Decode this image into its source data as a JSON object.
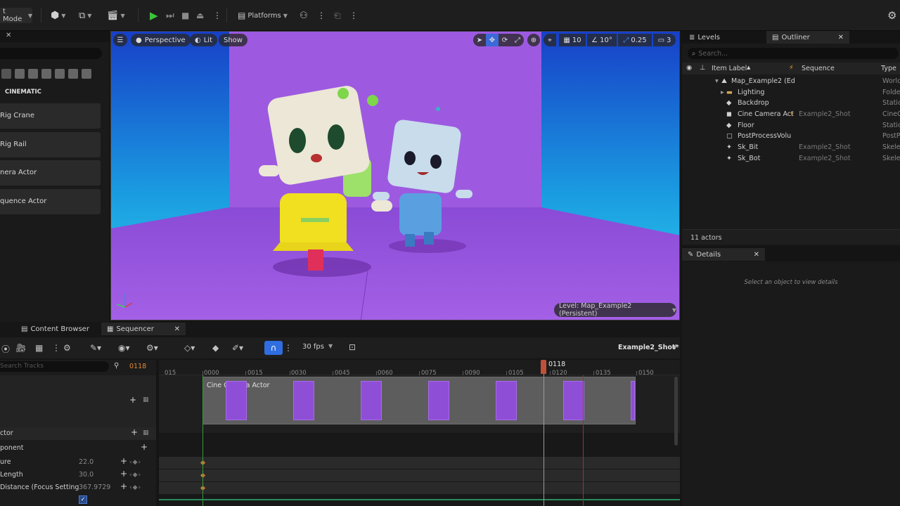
{
  "toolbar": {
    "mode_label": "t Mode",
    "platforms_label": "Platforms"
  },
  "left_panel": {
    "section_title": "CINEMATIC",
    "items": [
      "Rig Crane",
      "Rig Rail",
      "nera Actor",
      "quence Actor"
    ]
  },
  "viewport": {
    "perspective_label": "Perspective",
    "lit_label": "Lit",
    "show_label": "Show",
    "grid_value": "10",
    "angle_value": "10°",
    "scale_value": "0.25",
    "camera_speed": "3",
    "level_label": "Level: Map_Example2 (Persistent)"
  },
  "outliner": {
    "levels_tab": "Levels",
    "outliner_tab": "Outliner",
    "search_placeholder": "Search...",
    "col_item_label": "Item Label",
    "col_sequence": "Sequence",
    "col_type": "Type",
    "rows": [
      {
        "label": "Map_Example2 (Ed",
        "sequence": "",
        "type": "World"
      },
      {
        "label": "Lighting",
        "sequence": "",
        "type": "Folder"
      },
      {
        "label": "Backdrop",
        "sequence": "",
        "type": "Static"
      },
      {
        "label": "Cine Camera Act",
        "sequence": "Example2_Shot",
        "type": "CineC"
      },
      {
        "label": "Floor",
        "sequence": "",
        "type": "Static"
      },
      {
        "label": "PostProcessVolu",
        "sequence": "",
        "type": "PostP"
      },
      {
        "label": "Sk_Bit",
        "sequence": "Example2_Shot",
        "type": "Skele"
      },
      {
        "label": "Sk_Bot",
        "sequence": "Example2_Shot",
        "type": "Skele"
      }
    ],
    "actor_count": "11 actors"
  },
  "details": {
    "tab_label": "Details",
    "empty_text": "Select an object to view details"
  },
  "sequencer": {
    "content_browser_tab": "Content Browser",
    "sequencer_tab": "Sequencer",
    "fps_label": "30 fps",
    "sequence_name": "Example2_Shot*",
    "search_placeholder": "Search Tracks",
    "current_frame": "0118",
    "playhead_label": "0118",
    "ticks": [
      "015",
      "0000",
      "0015",
      "0030",
      "0045",
      "0060",
      "0075",
      "0090",
      "0105",
      "0120",
      "0135",
      "0150"
    ],
    "clip_label": "Cine Camera Actor",
    "tracks": [
      {
        "label": "ctor",
        "value": ""
      },
      {
        "label": "ponent",
        "value": ""
      },
      {
        "label": "ure",
        "value": "22.0"
      },
      {
        "label": "Length",
        "value": "30.0"
      },
      {
        "label": "Distance (Focus Setting",
        "value": "367.9729"
      }
    ]
  },
  "colors": {
    "accent": "#4a8cff",
    "playhead": "#c0503a",
    "viewport_purple": "#9156d9",
    "play_green": "#3cc43c"
  }
}
